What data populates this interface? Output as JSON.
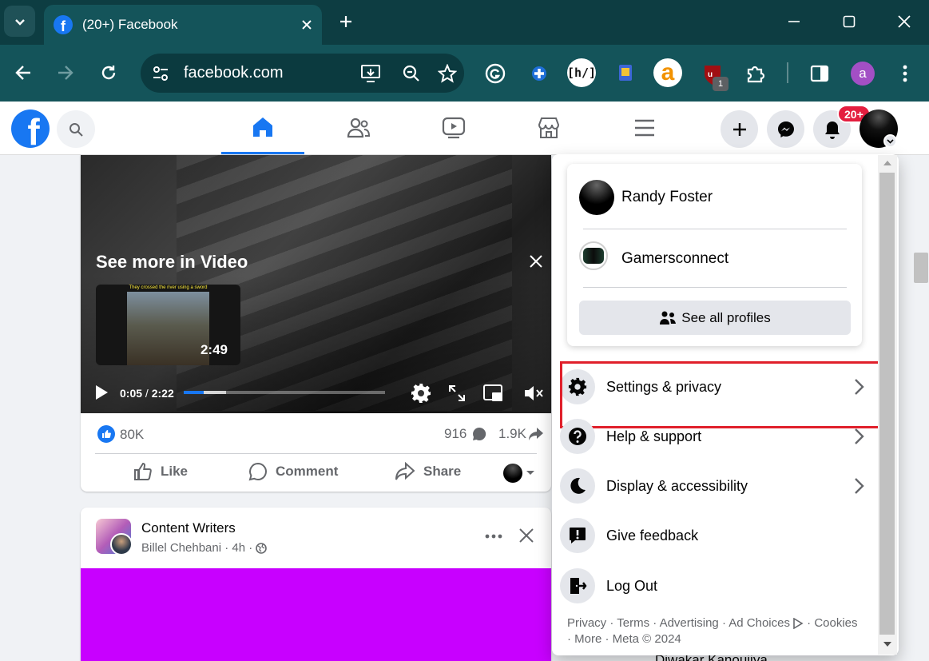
{
  "browser": {
    "tab_title": "(20+) Facebook",
    "url": "facebook.com",
    "extension_badge": "1",
    "profile_initial": "a"
  },
  "fb": {
    "notification_badge": "20+"
  },
  "video_post": {
    "overlay_title": "See more in Video",
    "thumb_caption": "They crossed the river using a sword",
    "thumb_duration": "2:49",
    "time_current": "0:05",
    "time_sep": " / ",
    "time_total": "2:22",
    "progress": 0.1,
    "buffered": 0.21,
    "likes": "80K",
    "comments": "916",
    "shares": "1.9K",
    "like_label": "Like",
    "comment_label": "Comment",
    "share_label": "Share"
  },
  "post2": {
    "group": "Content Writers",
    "author": "Billel Chehbani",
    "time": " · 4h · ",
    "image_color": "#c800ff"
  },
  "menu": {
    "profiles": [
      {
        "name": "Randy Foster"
      },
      {
        "name": "Gamersconnect"
      }
    ],
    "see_all": "See all profiles",
    "items": [
      {
        "label": "Settings & privacy",
        "icon": "gear-icon",
        "chevron": true
      },
      {
        "label": "Help & support",
        "icon": "question-icon",
        "chevron": true
      },
      {
        "label": "Display & accessibility",
        "icon": "moon-icon",
        "chevron": true
      },
      {
        "label": "Give feedback",
        "icon": "feedback-icon",
        "chevron": false
      },
      {
        "label": "Log Out",
        "icon": "logout-icon",
        "chevron": false
      }
    ],
    "footer_line1": "Privacy · Terms · Advertising · Ad Choices",
    "footer_cookies": " · Cookies",
    "footer_line2": "· More · Meta © 2024"
  },
  "behind_text": "Diwakar Kanoujiya",
  "colors": {
    "fb_blue": "#1877f2",
    "highlight": "#e0202b",
    "chrome_dark": "#0d3d42",
    "chrome_toolbar": "#14545a"
  }
}
